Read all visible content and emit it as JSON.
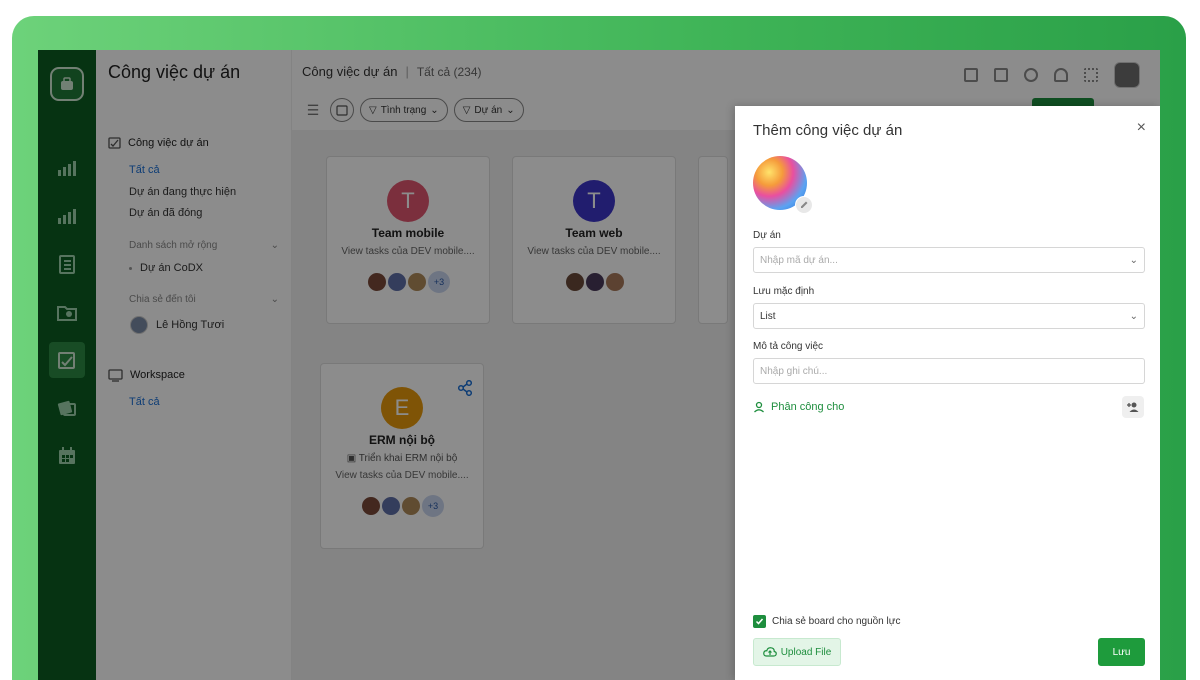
{
  "nav": {
    "title": "Công việc dự án",
    "group1_label": "Công việc dự án",
    "links": [
      "Tất cả",
      "Dự án đang thực hiện",
      "Dự án đã đóng"
    ],
    "extended_list_label": "Danh sách mở rộng",
    "extended_item": "Dự án CoDX",
    "shared_label": "Chia sẻ đến tôi",
    "shared_person": "Lê Hồng Tươi",
    "workspace_label": "Workspace",
    "workspace_link": "Tất cả"
  },
  "header": {
    "title": "Công việc dự án",
    "filter_label": "Tất cả (234)"
  },
  "filters": {
    "status": "Tình trạng",
    "project": "Dự án"
  },
  "cards": [
    {
      "initial": "T",
      "name": "Team mobile",
      "desc": "View tasks của DEV mobile....",
      "more": "+3",
      "color": "#e05670"
    },
    {
      "initial": "T",
      "name": "Team web",
      "desc": "View tasks của DEV mobile....",
      "more": "",
      "color": "#3c35c9"
    },
    {
      "initial": "E",
      "name": "ERM nội bộ",
      "plan": "Triển khai ERM nội bộ",
      "desc": "View tasks của DEV mobile....",
      "more": "+3",
      "color": "#e89a0c"
    }
  ],
  "modal": {
    "title": "Thêm công việc dự án",
    "close": "×",
    "project_label": "Dự án",
    "project_placeholder": "Nhập mã dự án...",
    "default_label": "Lưu mặc định",
    "default_value": "List",
    "desc_label": "Mô tả công việc",
    "desc_placeholder": "Nhập ghi chú...",
    "assign_label": "Phân công cho",
    "share_label": "Chia sẻ board cho nguồn lực",
    "share_checked": true,
    "upload_label": "Upload File",
    "save_label": "Lưu"
  },
  "colors": {
    "accent_green": "#1e8e3e",
    "rail_green": "#0b5e22",
    "link_blue": "#1a6fd6"
  }
}
